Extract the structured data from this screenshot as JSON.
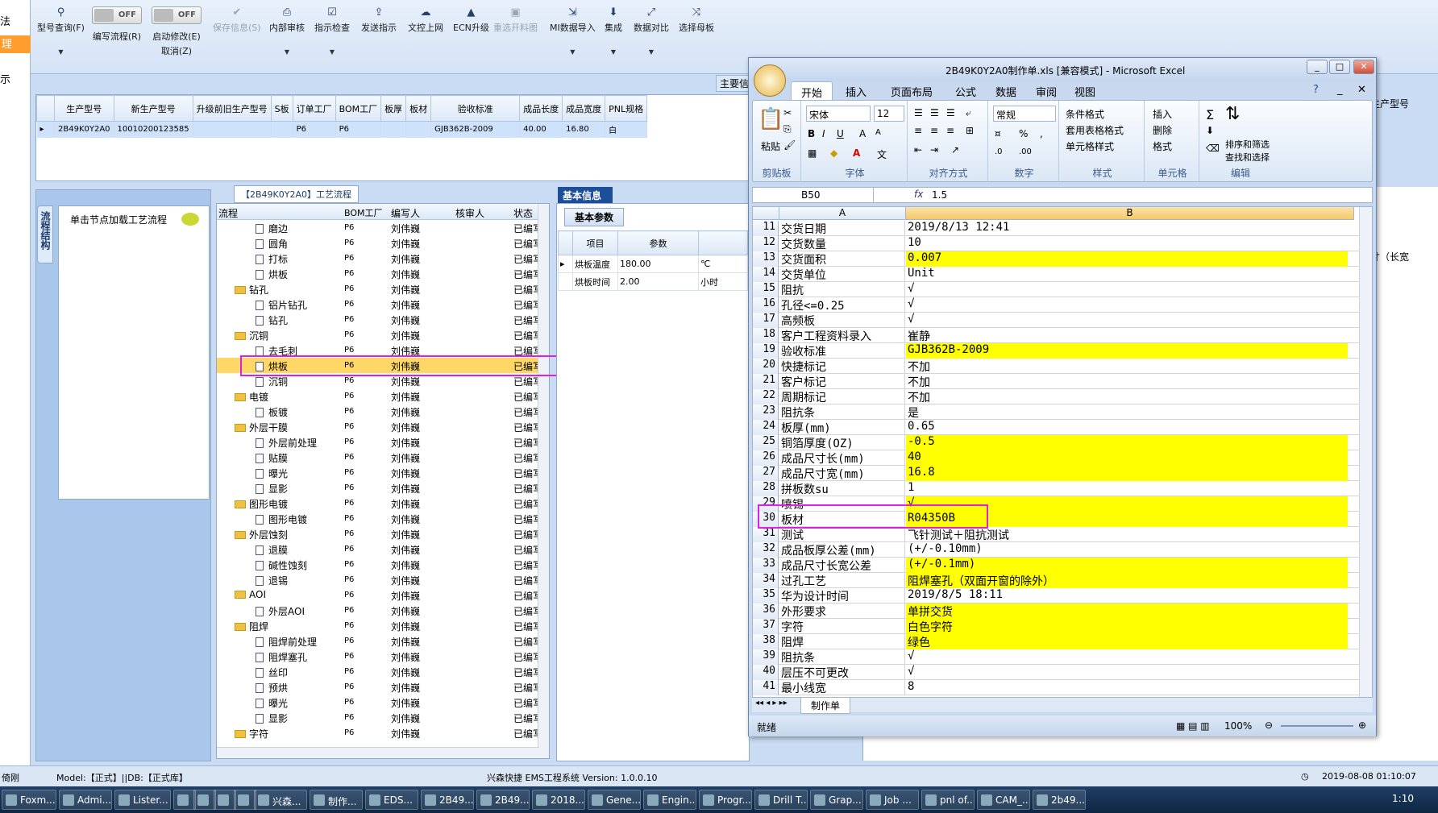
{
  "left_strip": {
    "items": [
      "法",
      "理",
      "示"
    ]
  },
  "toolbar": {
    "buttons": [
      {
        "label": "型号查询(F)",
        "icon": "search-icon",
        "enabled": true
      },
      {
        "label": "编写流程(R)",
        "toggle": "OFF"
      },
      {
        "label": "启动修改(E)",
        "label2": "取消(Z)",
        "toggle": "OFF"
      },
      {
        "label": "保存信息(S)",
        "icon": "check-icon",
        "enabled": false
      },
      {
        "label": "内部审核",
        "icon": "print-icon",
        "enabled": true
      },
      {
        "label": "指示检查",
        "icon": "checklist-icon",
        "enabled": true
      },
      {
        "label": "发送指示",
        "icon": "upload-icon",
        "enabled": true
      },
      {
        "label": "文控上网",
        "icon": "cloud-upload-icon",
        "enabled": true
      },
      {
        "label": "ECN升级",
        "icon": "ecn-icon",
        "enabled": true
      },
      {
        "label": "重选开料图",
        "icon": "image-icon",
        "enabled": false
      },
      {
        "label": "MI数据导入",
        "icon": "import-icon",
        "enabled": true
      },
      {
        "label": "集成",
        "icon": "download-icon",
        "enabled": true
      },
      {
        "label": "数据对比",
        "icon": "compare-icon",
        "enabled": true
      },
      {
        "label": "选择母板",
        "icon": "shuffle-icon",
        "enabled": true
      }
    ],
    "main_info_tab": "主要信"
  },
  "grid1": {
    "headers": [
      "生产型号",
      "新生产型号",
      "升级前旧生产型号",
      "S板",
      "订单工厂",
      "BOM工厂",
      "板厚",
      "板材",
      "验收标准",
      "成品长度",
      "成品宽度",
      "PNL规格"
    ],
    "row": [
      "2B49K0Y2A0",
      "10010200123585",
      "",
      "",
      "P6",
      "P6",
      "",
      "",
      "GJB362B-2009",
      "40.00",
      "16.80",
      "白"
    ]
  },
  "left_panel": {
    "vertical_tab": "流程结构",
    "node_hint": "单击节点加载工艺流程"
  },
  "flow": {
    "title": "【2B49K0Y2A0】工艺流程",
    "headers": [
      "流程",
      "BOM工厂",
      "编写人",
      "核审人",
      "状态"
    ],
    "rows": [
      {
        "name": "磨边",
        "level": 2,
        "bom": "P6",
        "writer": "刘伟巍",
        "status": "已编写"
      },
      {
        "name": "圆角",
        "level": 2,
        "bom": "P6",
        "writer": "刘伟巍",
        "status": "已编写"
      },
      {
        "name": "打标",
        "level": 2,
        "bom": "P6",
        "writer": "刘伟巍",
        "status": "已编写"
      },
      {
        "name": "烘板",
        "level": 2,
        "bom": "P6",
        "writer": "刘伟巍",
        "status": "已编写"
      },
      {
        "name": "钻孔",
        "level": 1,
        "bom": "P6",
        "writer": "刘伟巍",
        "status": "已编写"
      },
      {
        "name": "铝片钻孔",
        "level": 2,
        "bom": "P6",
        "writer": "刘伟巍",
        "status": "已编写"
      },
      {
        "name": "钻孔",
        "level": 2,
        "bom": "P6",
        "writer": "刘伟巍",
        "status": "已编写"
      },
      {
        "name": "沉铜",
        "level": 1,
        "bom": "P6",
        "writer": "刘伟巍",
        "status": "已编写"
      },
      {
        "name": "去毛刺",
        "level": 2,
        "bom": "P6",
        "writer": "刘伟巍",
        "status": "已编写"
      },
      {
        "name": "烘板",
        "level": 2,
        "bom": "P6",
        "writer": "刘伟巍",
        "status": "已编写",
        "selected": true
      },
      {
        "name": "沉铜",
        "level": 2,
        "bom": "P6",
        "writer": "刘伟巍",
        "status": "已编写"
      },
      {
        "name": "电镀",
        "level": 1,
        "bom": "P6",
        "writer": "刘伟巍",
        "status": "已编写"
      },
      {
        "name": "板镀",
        "level": 2,
        "bom": "P6",
        "writer": "刘伟巍",
        "status": "已编写"
      },
      {
        "name": "外层干膜",
        "level": 1,
        "bom": "P6",
        "writer": "刘伟巍",
        "status": "已编写"
      },
      {
        "name": "外层前处理",
        "level": 2,
        "bom": "P6",
        "writer": "刘伟巍",
        "status": "已编写"
      },
      {
        "name": "贴膜",
        "level": 2,
        "bom": "P6",
        "writer": "刘伟巍",
        "status": "已编写"
      },
      {
        "name": "曝光",
        "level": 2,
        "bom": "P6",
        "writer": "刘伟巍",
        "status": "已编写"
      },
      {
        "name": "显影",
        "level": 2,
        "bom": "P6",
        "writer": "刘伟巍",
        "status": "已编写"
      },
      {
        "name": "图形电镀",
        "level": 1,
        "bom": "P6",
        "writer": "刘伟巍",
        "status": "已编写"
      },
      {
        "name": "图形电镀",
        "level": 2,
        "bom": "P6",
        "writer": "刘伟巍",
        "status": "已编写"
      },
      {
        "name": "外层蚀刻",
        "level": 1,
        "bom": "P6",
        "writer": "刘伟巍",
        "status": "已编写"
      },
      {
        "name": "退膜",
        "level": 2,
        "bom": "P6",
        "writer": "刘伟巍",
        "status": "已编写"
      },
      {
        "name": "碱性蚀刻",
        "level": 2,
        "bom": "P6",
        "writer": "刘伟巍",
        "status": "已编写"
      },
      {
        "name": "退锡",
        "level": 2,
        "bom": "P6",
        "writer": "刘伟巍",
        "status": "已编写"
      },
      {
        "name": "AOI",
        "level": 1,
        "bom": "P6",
        "writer": "刘伟巍",
        "status": "已编写"
      },
      {
        "name": "外层AOI",
        "level": 2,
        "bom": "P6",
        "writer": "刘伟巍",
        "status": "已编写"
      },
      {
        "name": "阻焊",
        "level": 1,
        "bom": "P6",
        "writer": "刘伟巍",
        "status": "已编写"
      },
      {
        "name": "阻焊前处理",
        "level": 2,
        "bom": "P6",
        "writer": "刘伟巍",
        "status": "已编写"
      },
      {
        "name": "阻焊塞孔",
        "level": 2,
        "bom": "P6",
        "writer": "刘伟巍",
        "status": "已编写"
      },
      {
        "name": "丝印",
        "level": 2,
        "bom": "P6",
        "writer": "刘伟巍",
        "status": "已编写"
      },
      {
        "name": "预烘",
        "level": 2,
        "bom": "P6",
        "writer": "刘伟巍",
        "status": "已编写"
      },
      {
        "name": "曝光",
        "level": 2,
        "bom": "P6",
        "writer": "刘伟巍",
        "status": "已编写"
      },
      {
        "name": "显影",
        "level": 2,
        "bom": "P6",
        "writer": "刘伟巍",
        "status": "已编写"
      },
      {
        "name": "字符",
        "level": 1,
        "bom": "P6",
        "writer": "刘伟巍",
        "status": "已编写"
      }
    ]
  },
  "info": {
    "tab": "基本信息",
    "subtab": "基本参数",
    "headers": [
      "项目",
      "参数"
    ],
    "rows": [
      {
        "item": "烘板温度",
        "value": "180.00",
        "unit": "℃"
      },
      {
        "item": "烘板时间",
        "value": "2.00",
        "unit": "小时"
      }
    ]
  },
  "right": {
    "label1": "生产型号",
    "label2": "寸（长宽"
  },
  "excel": {
    "title": "2B49K0Y2A0制作单.xls  [兼容模式] - Microsoft Excel",
    "tabs": [
      "开始",
      "插入",
      "页面布局",
      "公式",
      "数据",
      "审阅",
      "视图"
    ],
    "ribbon": {
      "clipboard": {
        "group": "剪贴板",
        "paste": "粘贴"
      },
      "font": {
        "group": "字体",
        "name": "宋体",
        "size": "12"
      },
      "align": {
        "group": "对齐方式"
      },
      "number": {
        "group": "数字",
        "format": "常规"
      },
      "styles": {
        "group": "样式",
        "items": [
          "条件格式",
          "套用表格格式",
          "单元格样式"
        ]
      },
      "cells": {
        "group": "单元格",
        "items": [
          "插入",
          "删除",
          "格式"
        ]
      },
      "edit": {
        "group": "编辑",
        "sort": "排序和筛选",
        "find": "查找和选择"
      }
    },
    "name_box": "B50",
    "formula": "1.5",
    "columns": [
      "A",
      "B"
    ],
    "rows": [
      {
        "n": "11",
        "a": "交货日期",
        "b": "2019/8/13 12:41",
        "y": false
      },
      {
        "n": "12",
        "a": "交货数量",
        "b": "10",
        "y": false
      },
      {
        "n": "13",
        "a": "交货面积",
        "b": "0.007",
        "y": true
      },
      {
        "n": "14",
        "a": "交货单位",
        "b": "Unit",
        "y": false
      },
      {
        "n": "15",
        "a": "阻抗",
        "b": "√",
        "y": false
      },
      {
        "n": "16",
        "a": "孔径<=0.25",
        "b": "√",
        "y": false
      },
      {
        "n": "17",
        "a": "高频板",
        "b": "√",
        "y": false
      },
      {
        "n": "18",
        "a": "客户工程资料录入",
        "b": "崔静",
        "y": false
      },
      {
        "n": "19",
        "a": "验收标准",
        "b": "GJB362B-2009",
        "y": true
      },
      {
        "n": "20",
        "a": "快捷标记",
        "b": "不加",
        "y": false
      },
      {
        "n": "21",
        "a": "客户标记",
        "b": "不加",
        "y": false
      },
      {
        "n": "22",
        "a": "周期标记",
        "b": "不加",
        "y": false
      },
      {
        "n": "23",
        "a": "阻抗条",
        "b": "是",
        "y": false
      },
      {
        "n": "24",
        "a": "板厚(mm)",
        "b": "0.65",
        "y": false
      },
      {
        "n": "25",
        "a": "铜箔厚度(OZ)",
        "b": "-0.5",
        "y": true
      },
      {
        "n": "26",
        "a": "成品尺寸长(mm)",
        "b": "40",
        "y": true
      },
      {
        "n": "27",
        "a": "成品尺寸宽(mm)",
        "b": "16.8",
        "y": true
      },
      {
        "n": "28",
        "a": "拼板数su",
        "b": "1",
        "y": false
      },
      {
        "n": "29",
        "a": "喷锡",
        "b": "√",
        "y": true
      },
      {
        "n": "30",
        "a": "板材",
        "b": "R04350B",
        "y": true
      },
      {
        "n": "31",
        "a": "测试",
        "b": "飞针测试＋阻抗测试",
        "y": false
      },
      {
        "n": "32",
        "a": "成品板厚公差(mm)",
        "b": "(+/-0.10mm)",
        "y": false
      },
      {
        "n": "33",
        "a": "成品尺寸长宽公差",
        "b": "(+/-0.1mm)",
        "y": true
      },
      {
        "n": "34",
        "a": "过孔工艺",
        "b": "阻焊塞孔（双面开窗的除外）",
        "y": true
      },
      {
        "n": "35",
        "a": "华为设计时间",
        "b": "2019/8/5 18:11",
        "y": false
      },
      {
        "n": "36",
        "a": "外形要求",
        "b": "单拼交货",
        "y": true
      },
      {
        "n": "37",
        "a": "字符",
        "b": "白色字符",
        "y": true
      },
      {
        "n": "38",
        "a": "阻焊",
        "b": "绿色",
        "y": true
      },
      {
        "n": "39",
        "a": "阻抗条",
        "b": "√",
        "y": false
      },
      {
        "n": "40",
        "a": "层压不可更改",
        "b": "√",
        "y": false
      },
      {
        "n": "41",
        "a": "最小线宽",
        "b": "8",
        "y": false
      }
    ],
    "sheet_tab": "制作单",
    "status": "就绪",
    "zoom": "100%"
  },
  "statusbar": {
    "left": "倚刚",
    "model": "Model:【正式】||DB:【正式库】",
    "center": "兴森快捷 EMS工程系统 Version: 1.0.0.10",
    "datetime": "2019-08-08 01:10:07"
  },
  "taskbar": {
    "items": [
      "Foxm...",
      "Admi...",
      "Lister...",
      "",
      "",
      "",
      "",
      "兴森...",
      "制作...",
      "EDS...",
      "2B49...",
      "2B49...",
      "2018...",
      "Gene...",
      "Engin...",
      "Progr...",
      "Drill T...",
      "Grap...",
      "Job ...",
      "pnl of...",
      "CAM_...",
      "2b49..."
    ],
    "clock": "1:10"
  },
  "colors": {
    "accent": "#1c4f98",
    "highlight_box": "#e020e0",
    "cell_yellow": "#ffff00"
  }
}
